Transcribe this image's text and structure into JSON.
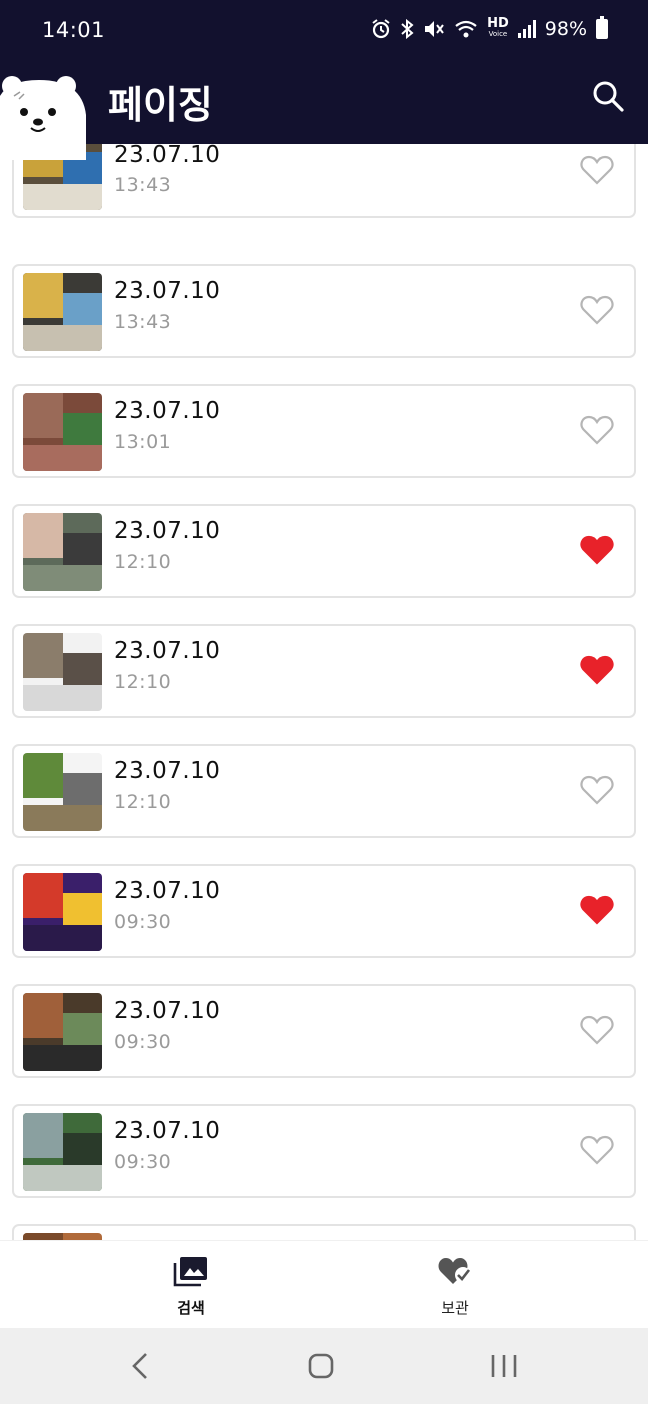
{
  "status_bar": {
    "time": "14:01",
    "battery_percent": "98%",
    "network_label": "HD",
    "network_sublabel": "Voice",
    "icons": [
      "alarm-icon",
      "bluetooth-icon",
      "mute-icon",
      "wifi-icon",
      "signal-icon",
      "battery-icon"
    ]
  },
  "app_bar": {
    "title": "페이징",
    "search_icon": "search-icon",
    "mascot": "bear-mascot"
  },
  "items": [
    {
      "date": "23.07.10",
      "time": "13:43",
      "favorited": false,
      "thumb_colors": [
        "#5a4e3c",
        "#c9a23a",
        "#2f6fb0",
        "#e1dccf"
      ]
    },
    {
      "date": "23.07.10",
      "time": "13:43",
      "favorited": false,
      "thumb_colors": [
        "#3b3a36",
        "#d9b24a",
        "#6aa0c8",
        "#c7c0b0"
      ]
    },
    {
      "date": "23.07.10",
      "time": "13:01",
      "favorited": false,
      "thumb_colors": [
        "#7b4a3a",
        "#9a6a58",
        "#3f7a3e",
        "#a86c5e"
      ]
    },
    {
      "date": "23.07.10",
      "time": "12:10",
      "favorited": true,
      "thumb_colors": [
        "#5d6a5a",
        "#d6b8a6",
        "#3b3b3b",
        "#7f8c78"
      ]
    },
    {
      "date": "23.07.10",
      "time": "12:10",
      "favorited": true,
      "thumb_colors": [
        "#f2f2f2",
        "#8b7d6b",
        "#5a5048",
        "#d8d8d8"
      ]
    },
    {
      "date": "23.07.10",
      "time": "12:10",
      "favorited": false,
      "thumb_colors": [
        "#f4f4f4",
        "#5f8a3a",
        "#6d6d6d",
        "#8a7a5a"
      ]
    },
    {
      "date": "23.07.10",
      "time": "09:30",
      "favorited": true,
      "thumb_colors": [
        "#3a1f6a",
        "#d43a2a",
        "#f0c030",
        "#2a1a4a"
      ]
    },
    {
      "date": "23.07.10",
      "time": "09:30",
      "favorited": false,
      "thumb_colors": [
        "#4a3a2a",
        "#a0603a",
        "#6c8a5a",
        "#2a2a2a"
      ]
    },
    {
      "date": "23.07.10",
      "time": "09:30",
      "favorited": false,
      "thumb_colors": [
        "#3f6a3a",
        "#8aa0a0",
        "#2a3a2a",
        "#c0c8c0"
      ]
    },
    {
      "date": "",
      "time": "",
      "favorited": false,
      "thumb_colors": [
        "#b06a3a",
        "#7a4a2a",
        "#d08a4a",
        "#5a3a2a"
      ]
    }
  ],
  "bottom_nav": {
    "search_label": "검색",
    "saved_label": "보관",
    "search_icon": "photo-library-icon",
    "saved_icon": "heart-check-icon"
  },
  "colors": {
    "header_bg": "#12112e",
    "heart_active": "#e8222a",
    "heart_outline": "#b5b5b5",
    "card_border": "#e3e3e3"
  }
}
